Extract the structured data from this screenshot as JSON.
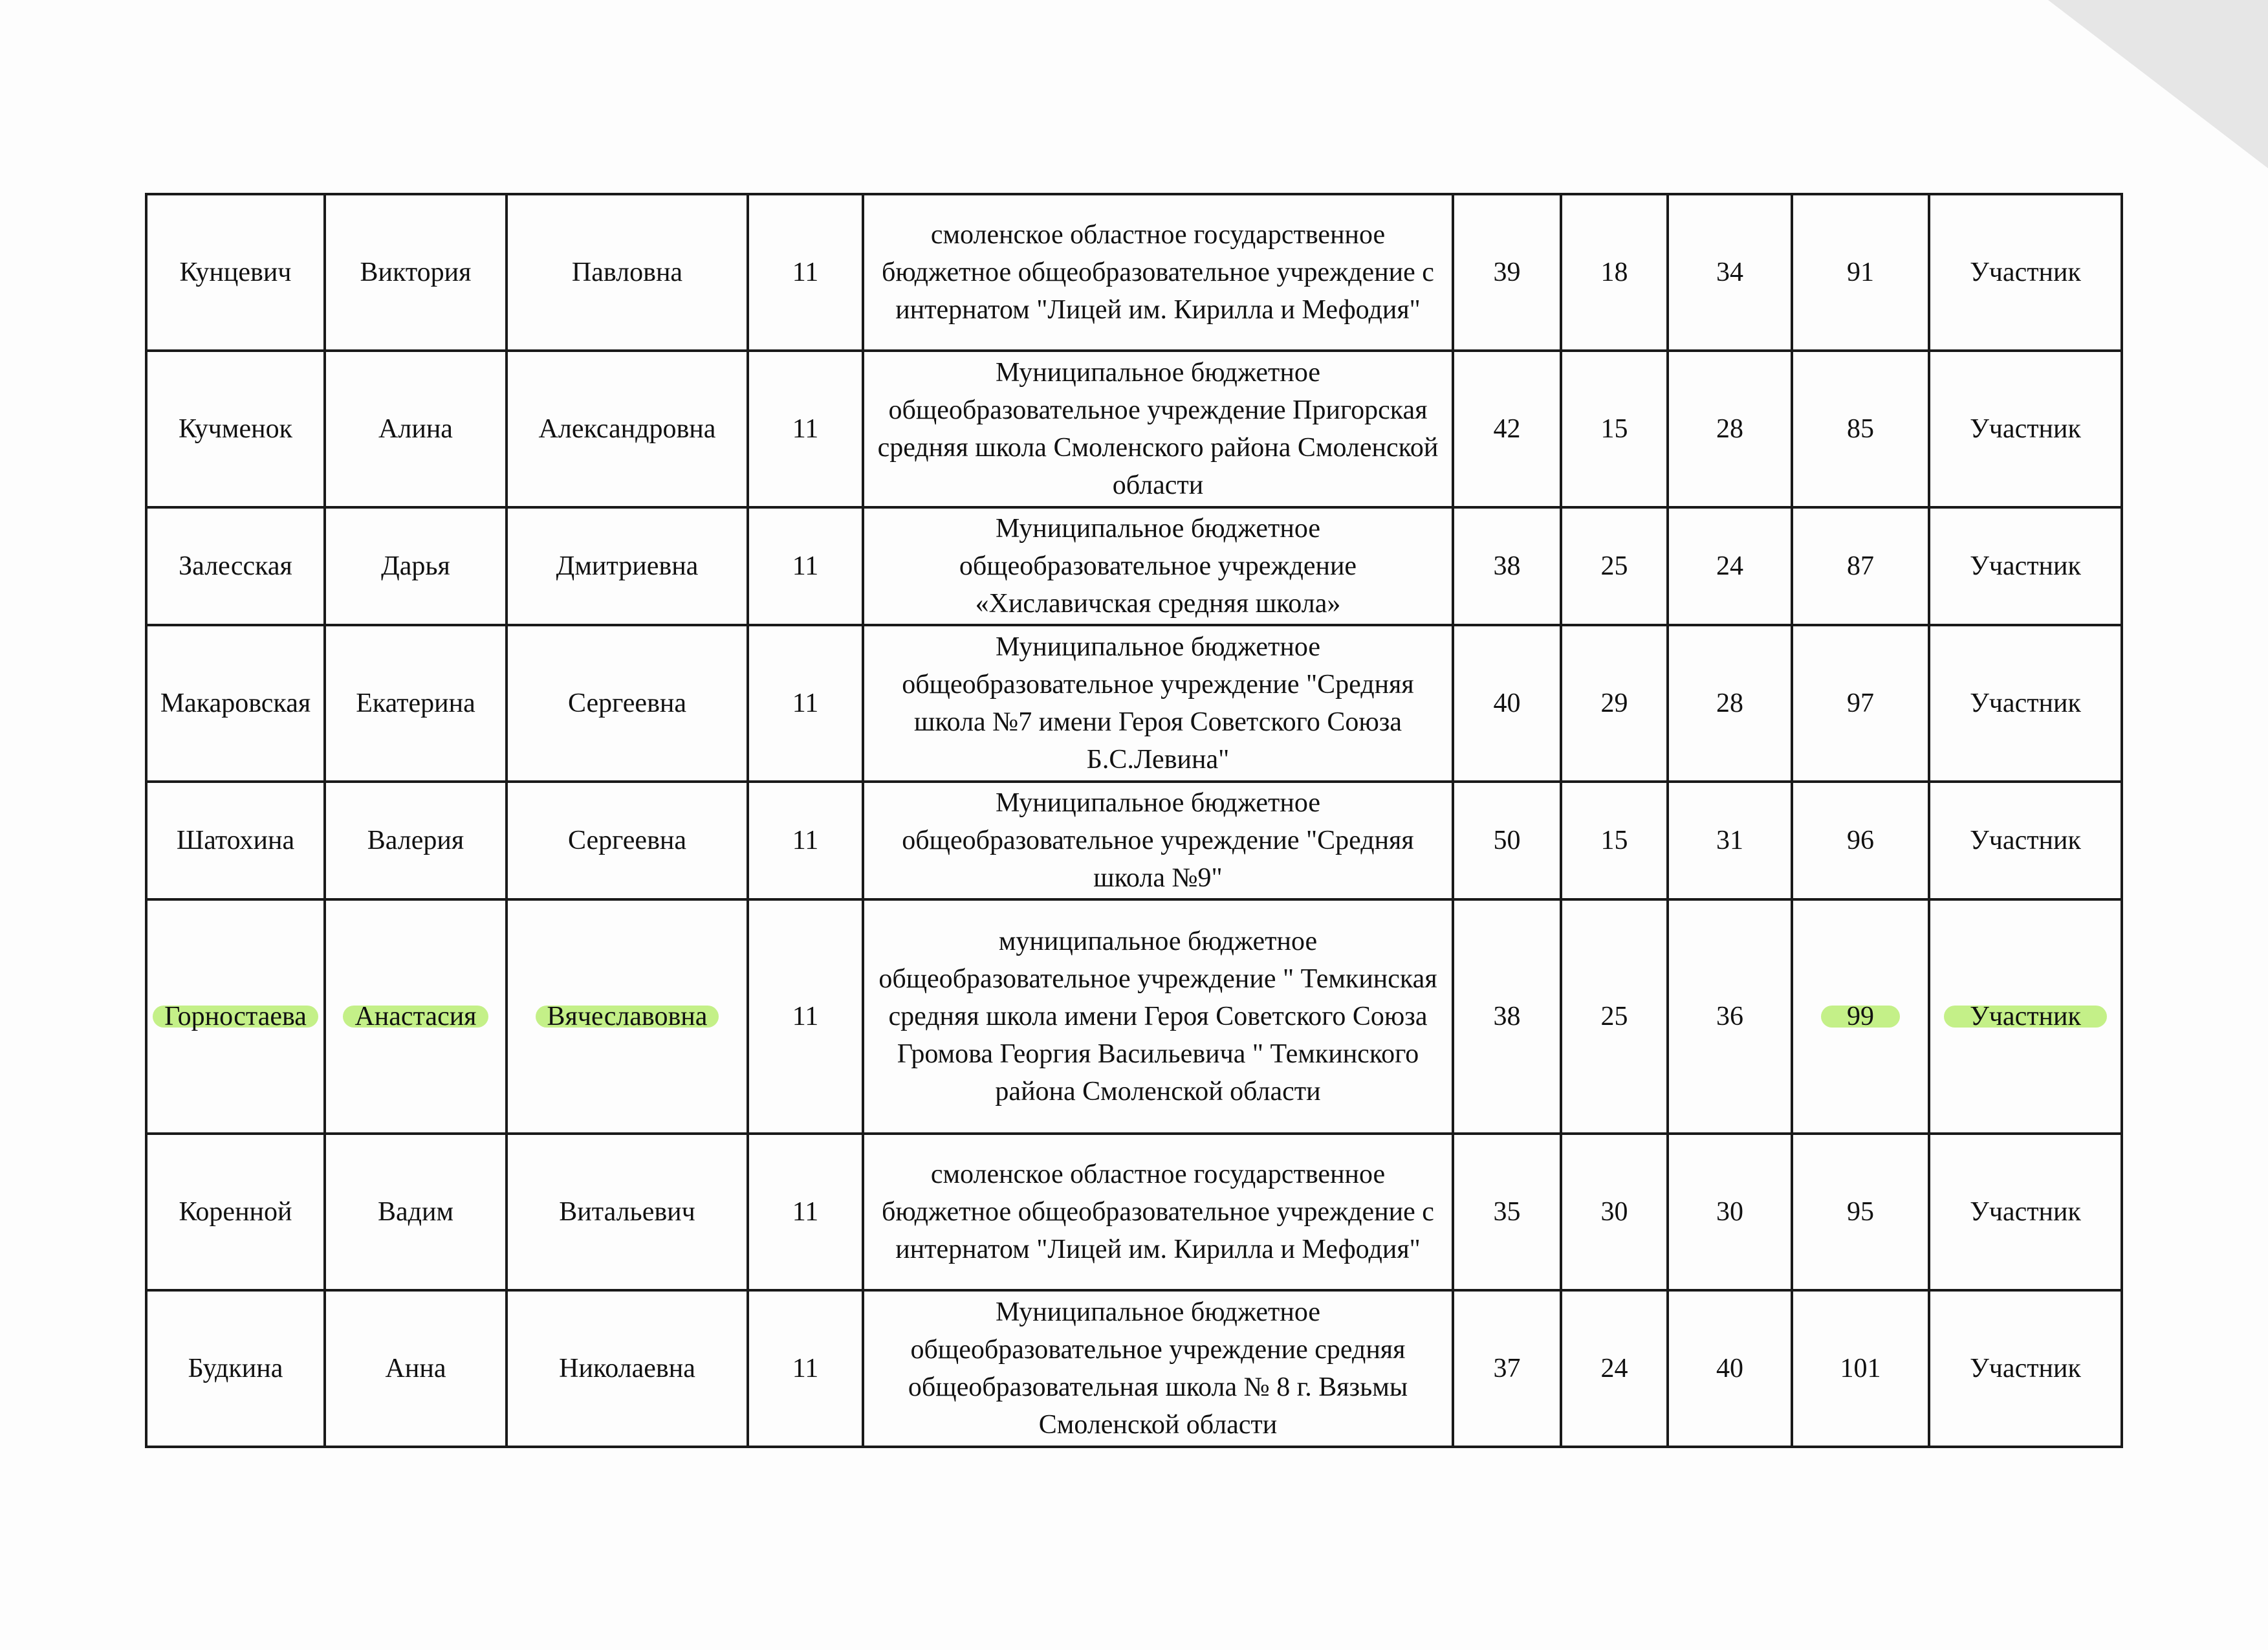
{
  "rows": [
    {
      "surname": "Кунцевич",
      "name": "Виктория",
      "patronymic": "Павловна",
      "grade": "11",
      "school": "смоленское областное государственное бюджетное общеобразовательное учреждение с интернатом \"Лицей им. Кирилла и Мефодия\"",
      "score1": "39",
      "score2": "18",
      "score3": "34",
      "total": "91",
      "status": "Участник",
      "highlighted": false
    },
    {
      "surname": "Кучменок",
      "name": "Алина",
      "patronymic": "Александровна",
      "grade": "11",
      "school": "Муниципальное бюджетное общеобразовательное учреждение Пригорская средняя школа Смоленского района Смоленской области",
      "score1": "42",
      "score2": "15",
      "score3": "28",
      "total": "85",
      "status": "Участник",
      "highlighted": false
    },
    {
      "surname": "Залесская",
      "name": "Дарья",
      "patronymic": "Дмитриевна",
      "grade": "11",
      "school": "Муниципальное бюджетное общеобразовательное учреждение «Хиславичская средняя школа»",
      "score1": "38",
      "score2": "25",
      "score3": "24",
      "total": "87",
      "status": "Участник",
      "highlighted": false
    },
    {
      "surname": "Макаровская",
      "name": "Екатерина",
      "patronymic": "Сергеевна",
      "grade": "11",
      "school": "Муниципальное бюджетное общеобразовательное учреждение \"Средняя школа №7 имени Героя Советского Союза Б.С.Левина\"",
      "score1": "40",
      "score2": "29",
      "score3": "28",
      "total": "97",
      "status": "Участник",
      "highlighted": false
    },
    {
      "surname": "Шатохина",
      "name": "Валерия",
      "patronymic": "Сергеевна",
      "grade": "11",
      "school": "Муниципальное бюджетное общеобразовательное учреждение \"Средняя школа №9\"",
      "score1": "50",
      "score2": "15",
      "score3": "31",
      "total": "96",
      "status": "Участник",
      "highlighted": false
    },
    {
      "surname": "Горностаева",
      "name": "Анастасия",
      "patronymic": "Вячеславовна",
      "grade": "11",
      "school": "муниципальное бюджетное общеобразовательное учреждение \" Темкинская средняя школа имени Героя Советского Союза Громова Георгия Васильевича \" Темкинского района Смоленской области",
      "score1": "38",
      "score2": "25",
      "score3": "36",
      "total": "99",
      "status": "Участник",
      "highlighted": true
    },
    {
      "surname": "Коренной",
      "name": "Вадим",
      "patronymic": "Витальевич",
      "grade": "11",
      "school": "смоленское областное государственное бюджетное общеобразовательное учреждение с интернатом \"Лицей им. Кирилла и Мефодия\"",
      "score1": "35",
      "score2": "30",
      "score3": "30",
      "total": "95",
      "status": "Участник",
      "highlighted": false
    },
    {
      "surname": "Будкина",
      "name": "Анна",
      "patronymic": "Николаевна",
      "grade": "11",
      "school": "Муниципальное бюджетное общеобразовательное учреждение средняя общеобразовательная школа № 8 г. Вязьмы Смоленской области",
      "score1": "37",
      "score2": "24",
      "score3": "40",
      "total": "101",
      "status": "Участник",
      "highlighted": false
    }
  ],
  "highlight_color": "#9be628"
}
